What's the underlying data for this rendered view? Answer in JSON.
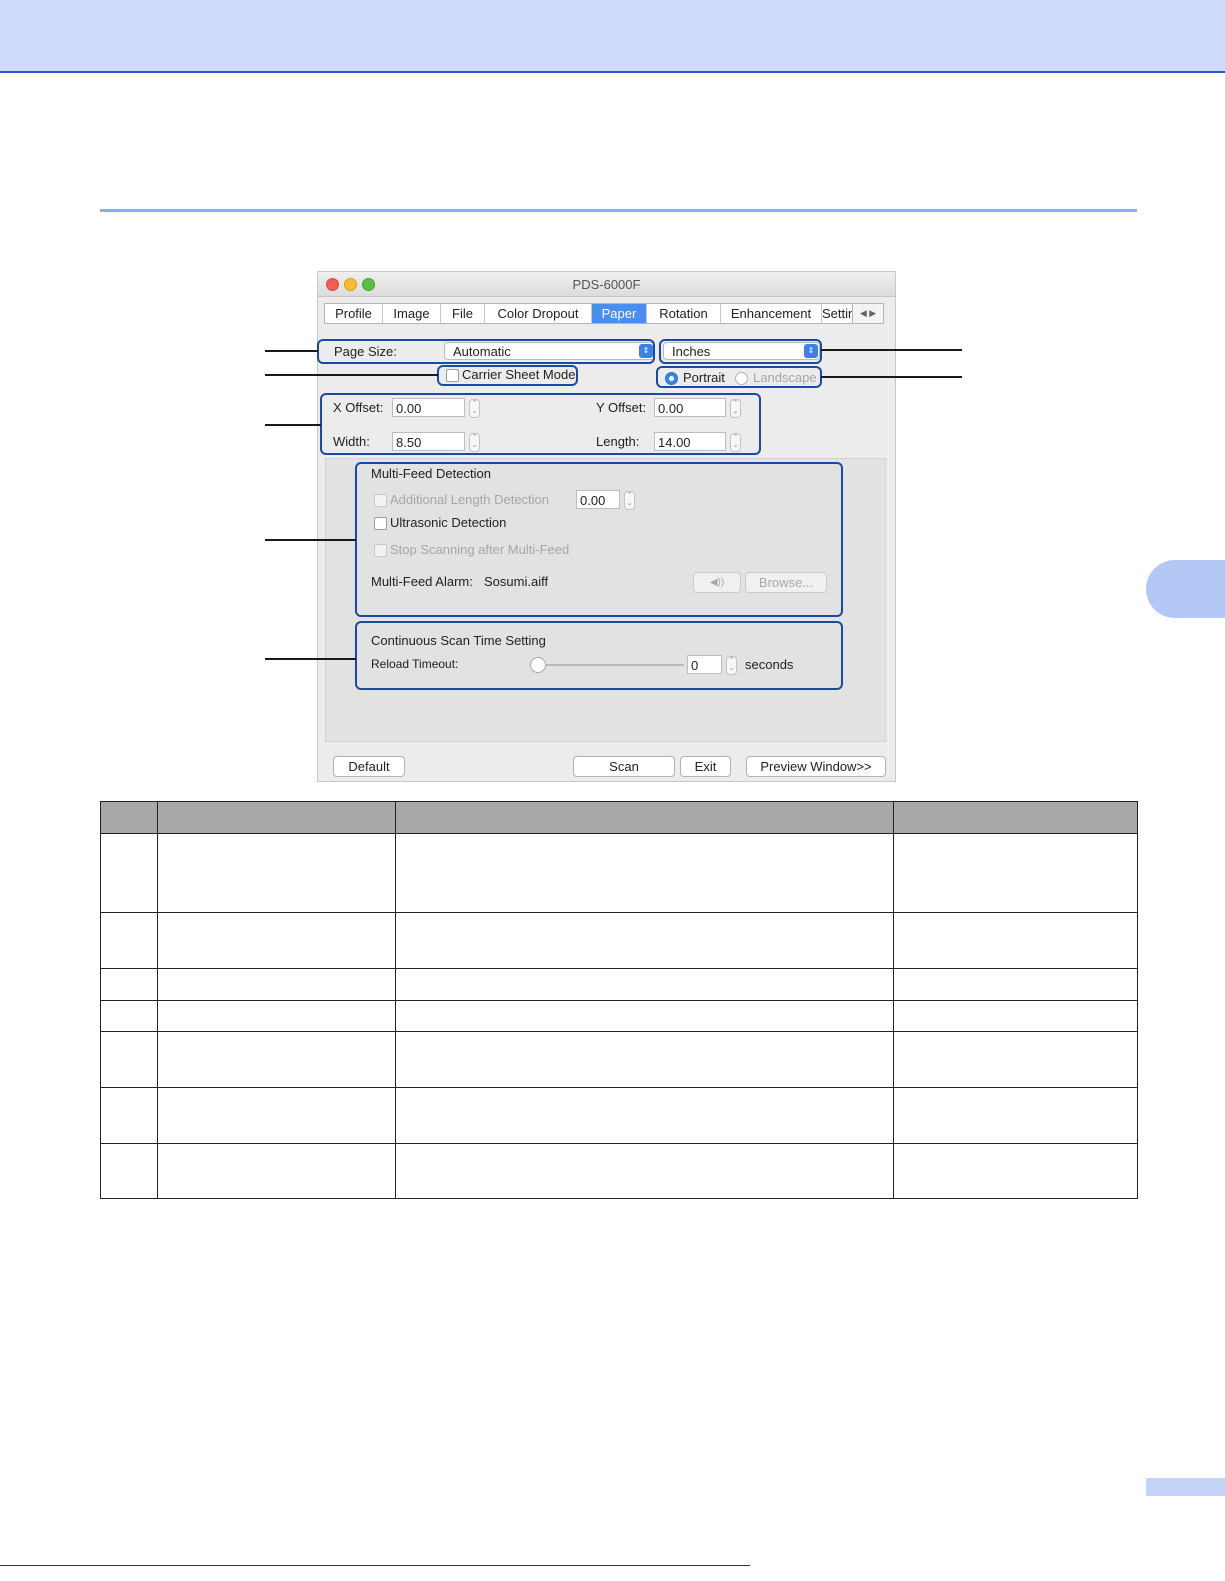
{
  "window": {
    "title": "PDS-6000F",
    "tabs": [
      "Profile",
      "Image",
      "File",
      "Color Dropout",
      "Paper",
      "Rotation",
      "Enhancement",
      "Setting"
    ],
    "active_tab": "Paper",
    "tab_scroll": "◀ ▶"
  },
  "paper": {
    "page_size_label": "Page Size:",
    "page_size_value": "Automatic",
    "units_value": "Inches",
    "carrier_sheet_label": "Carrier Sheet Mode",
    "portrait_label": "Portrait",
    "landscape_label": "Landscape",
    "x_offset_label": "X Offset:",
    "x_offset_value": "0.00",
    "y_offset_label": "Y Offset:",
    "y_offset_value": "0.00",
    "width_label": "Width:",
    "width_value": "8.50",
    "length_label": "Length:",
    "length_value": "14.00"
  },
  "multifeed": {
    "title": "Multi-Feed Detection",
    "additional_length_label": "Additional Length Detection",
    "additional_length_value": "0.00",
    "ultrasonic_label": "Ultrasonic Detection",
    "stop_scanning_label": "Stop Scanning after Multi-Feed",
    "alarm_label": "Multi-Feed Alarm:",
    "alarm_value": "Sosumi.aiff",
    "speaker_label": "◀))",
    "browse_label": "Browse..."
  },
  "continuous": {
    "title": "Continuous Scan Time Setting",
    "reload_label": "Reload Timeout:",
    "reload_value": "0",
    "seconds_label": "seconds",
    "slider_level": 0
  },
  "buttons": {
    "default_label": "Default",
    "scan_label": "Scan",
    "exit_label": "Exit",
    "preview_label": "Preview Window>>"
  },
  "table": {
    "rows": 7
  },
  "colors": {
    "header_band": "#cfdcfb",
    "accent_blue": "#1b4aa6",
    "table_header": "#a8a8a8"
  }
}
